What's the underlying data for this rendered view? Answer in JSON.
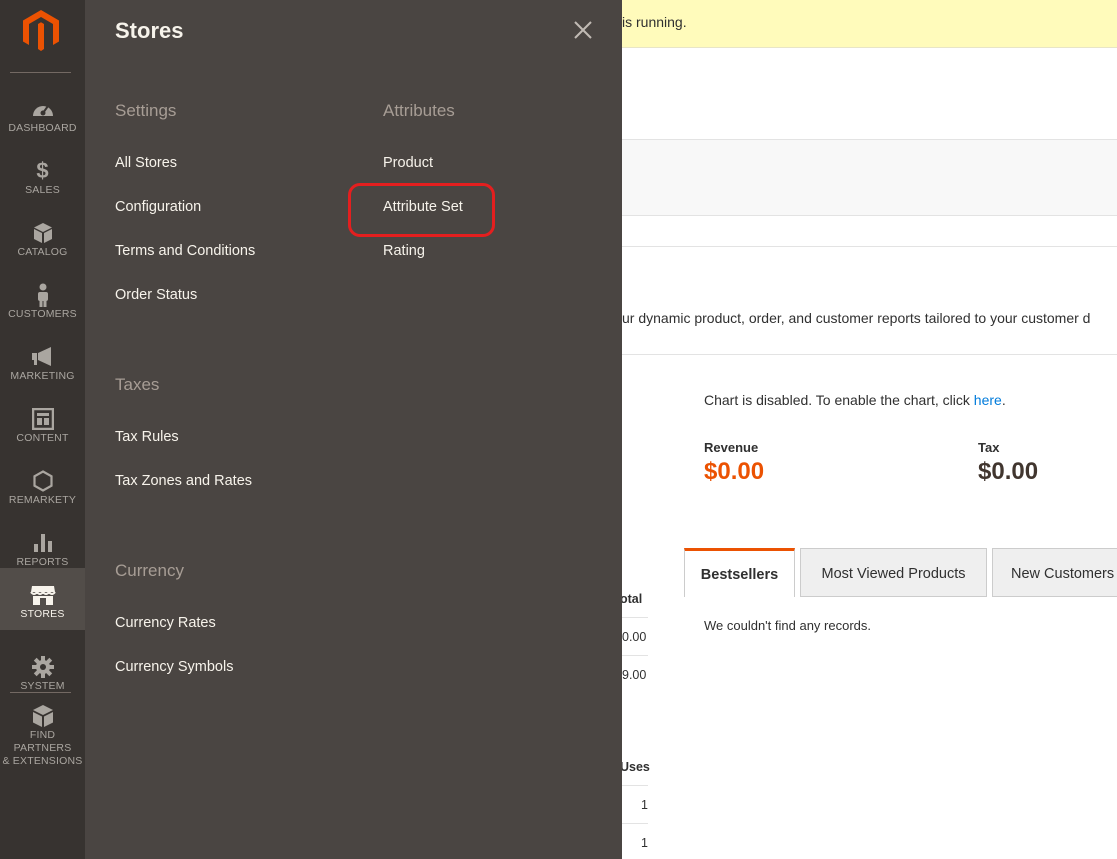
{
  "sidebar": {
    "logo": "magento-logo",
    "items": [
      {
        "label": "DASHBOARD",
        "icon": "dashboard-icon"
      },
      {
        "label": "SALES",
        "icon": "dollar-icon"
      },
      {
        "label": "CATALOG",
        "icon": "box-icon"
      },
      {
        "label": "CUSTOMERS",
        "icon": "person-icon"
      },
      {
        "label": "MARKETING",
        "icon": "megaphone-icon"
      },
      {
        "label": "CONTENT",
        "icon": "layout-icon"
      },
      {
        "label": "REMARKETY",
        "icon": "hexagon-icon"
      },
      {
        "label": "REPORTS",
        "icon": "bar-chart-icon"
      },
      {
        "label": "STORES",
        "icon": "store-icon",
        "active": true
      },
      {
        "label": "SYSTEM",
        "icon": "gear-icon"
      },
      {
        "label": "FIND PARTNERS\n& EXTENSIONS",
        "icon": "extensions-icon"
      }
    ]
  },
  "flyout": {
    "title": "Stores",
    "settings": {
      "heading": "Settings",
      "links": [
        "All Stores",
        "Configuration",
        "Terms and Conditions",
        "Order Status"
      ]
    },
    "attributes": {
      "heading": "Attributes",
      "links": [
        "Product",
        "Attribute Set",
        "Rating"
      ]
    },
    "taxes": {
      "heading": "Taxes",
      "links": [
        "Tax Rules",
        "Tax Zones and Rates"
      ]
    },
    "currency": {
      "heading": "Currency",
      "links": [
        "Currency Rates",
        "Currency Symbols"
      ]
    }
  },
  "content": {
    "notice": "is running.",
    "intro": "ur dynamic product, order, and customer reports tailored to your customer d",
    "chart_msg": "Chart is disabled. To enable the chart, click ",
    "chart_link": "here",
    "chart_msg_end": ".",
    "revenue_label": "Revenue",
    "revenue_value": "$0.00",
    "tax_label": "Tax",
    "tax_value": "$0.00",
    "tabs": [
      "Bestsellers",
      "Most Viewed Products",
      "New Customers"
    ],
    "tab_body": "We couldn't find any records.",
    "peek_total": "otal",
    "peek_total_1": "0.00",
    "peek_total_2": "9.00",
    "peek_uses": "Uses",
    "peek_uses_1": "1",
    "peek_uses_2": "1"
  },
  "colors": {
    "sidebar_bg": "#373330",
    "flyout_bg": "#4a4542",
    "accent_orange": "#eb5202",
    "highlight_red": "#e41f1f",
    "notice_bg": "#fffbbb",
    "link_blue": "#007bdb"
  }
}
